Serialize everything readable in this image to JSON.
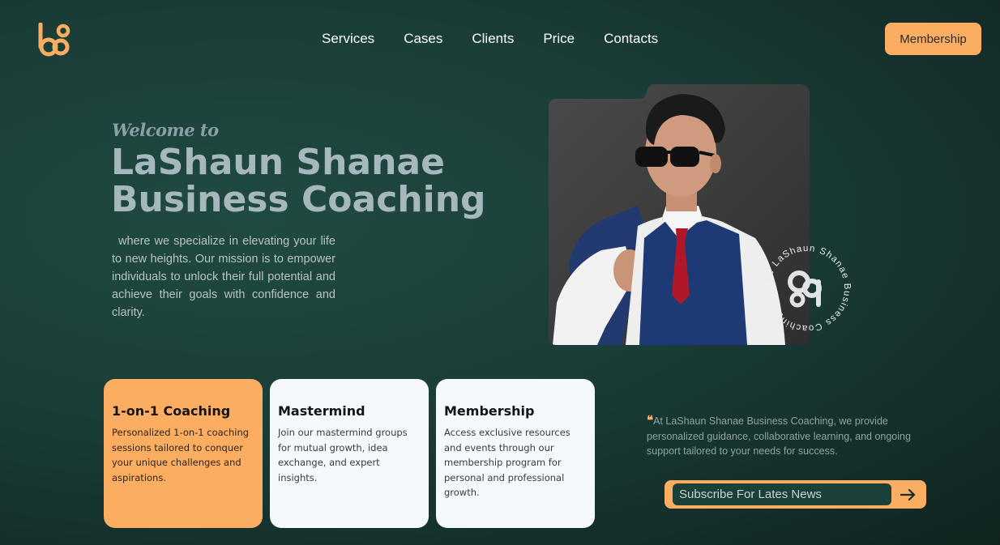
{
  "nav": {
    "items": [
      {
        "label": "Services"
      },
      {
        "label": "Cases"
      },
      {
        "label": "Clients"
      },
      {
        "label": "Price"
      },
      {
        "label": "Contacts"
      }
    ],
    "cta_label": "Membership"
  },
  "hero": {
    "welcome": "Welcome to",
    "title_line1": "LaShaun Shanae",
    "title_line2": "Business Coaching",
    "description": "where we specialize in elevating your life to new heights. Our mission is to empower individuals to unlock their full potential and achieve their goals with confidence and clarity.",
    "badge_text": "The LaShaun Shanae Business Coaching"
  },
  "cards": [
    {
      "title": "1-on-1 Coaching",
      "text": "Personalized 1-on-1 coaching sessions tailored to conquer your unique challenges and aspirations."
    },
    {
      "title": "Mastermind",
      "text": "Join our mastermind groups for mutual growth, idea exchange, and expert insights."
    },
    {
      "title": "Membership",
      "text": "Access exclusive resources and events through our membership program for personal and professional growth."
    }
  ],
  "quote": {
    "mark": "❝",
    "text": "At LaShaun Shanae Business Coaching, we provide personalized guidance, collaborative learning, and ongoing support tailored to your needs for success."
  },
  "subscribe": {
    "placeholder": "Subscribe For Lates News",
    "button_icon": "arrow-right-icon"
  },
  "colors": {
    "accent": "#fbae62",
    "background": "#1a3d37",
    "card_light": "#f5f8fd"
  }
}
